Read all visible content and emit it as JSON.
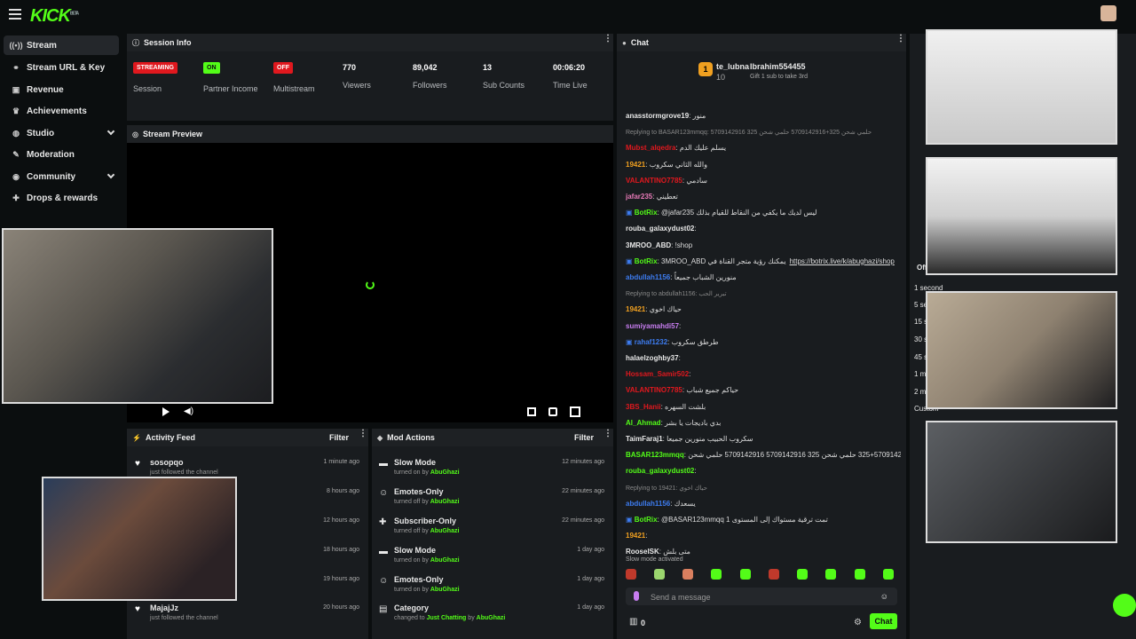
{
  "app": {
    "logo": "KICK",
    "logo_beta": "BETA"
  },
  "sidebar": {
    "items": [
      {
        "label": "Stream",
        "icon": "broadcast-icon",
        "active": true
      },
      {
        "label": "Stream URL & Key",
        "icon": "link-icon"
      },
      {
        "label": "Revenue",
        "icon": "revenue-icon"
      },
      {
        "label": "Achievements",
        "icon": "trophy-icon"
      },
      {
        "label": "Studio",
        "icon": "globe-icon",
        "expandable": true
      },
      {
        "label": "Moderation",
        "icon": "wrench-icon"
      },
      {
        "label": "Community",
        "icon": "community-icon",
        "expandable": true
      },
      {
        "label": "Drops & rewards",
        "icon": "gift-icon"
      }
    ]
  },
  "session": {
    "title": "Session Info",
    "stats": [
      {
        "badge": "STREAMING",
        "badge_color": "#e0181e",
        "label": "Session"
      },
      {
        "badge": "ON",
        "badge_color": "#53fc18",
        "label": "Partner Income"
      },
      {
        "badge": "OFF",
        "badge_color": "#e0181e",
        "label": "Multistream"
      },
      {
        "value": "770",
        "label": "Viewers"
      },
      {
        "value": "89,042",
        "label": "Followers"
      },
      {
        "value": "13",
        "label": "Sub Counts"
      },
      {
        "value": "00:06:20",
        "label": "Time Live"
      }
    ]
  },
  "preview": {
    "title": "Stream Preview"
  },
  "activity": {
    "title": "Activity Feed",
    "filter": "Filter",
    "rows": [
      {
        "user": "sosopqo",
        "action": "just followed the channel",
        "time": "1 minute ago"
      },
      {
        "user": "",
        "action": "",
        "time": "8 hours ago"
      },
      {
        "user": "",
        "action": "",
        "time": "12 hours ago"
      },
      {
        "user": "",
        "action": "",
        "time": "18 hours ago"
      },
      {
        "user": "",
        "action": "",
        "time": "19 hours ago"
      },
      {
        "user": "MajajJz",
        "action": "just followed the channel",
        "time": "20 hours ago"
      }
    ]
  },
  "mod": {
    "title": "Mod Actions",
    "filter": "Filter",
    "rows": [
      {
        "title": "Slow Mode",
        "pre": "turned on by",
        "by": "AbuGhazi",
        "time": "12 minutes ago"
      },
      {
        "title": "Emotes-Only",
        "pre": "turned off by",
        "by": "AbuGhazi",
        "time": "22 minutes ago"
      },
      {
        "title": "Subscriber-Only",
        "pre": "turned off by",
        "by": "AbuGhazi",
        "time": "22 minutes ago"
      },
      {
        "title": "Slow Mode",
        "pre": "turned on by",
        "by": "AbuGhazi",
        "time": "1 day ago"
      },
      {
        "title": "Emotes-Only",
        "pre": "turned on by",
        "by": "AbuGhazi",
        "time": "1 day ago"
      },
      {
        "title": "Category",
        "pre": "changed to",
        "cat": "Just Chatting",
        "by_pre": "by",
        "by": "AbuGhazi",
        "time": "1 day ago"
      }
    ]
  },
  "chat": {
    "title": "Chat",
    "pinned": {
      "rank": "1",
      "user": "te_lubna",
      "count": "10",
      "user2": "Ibrahim554455",
      "gift": "Gift 1 sub to take 3rd"
    },
    "messages": [
      {
        "user": "anasstormgrove19",
        "color": "#e8e8e8",
        "text": "منور"
      },
      {
        "reply": "Replying to BASAR123mmqq: 5709142916 حلمي شحن 325+5709142916 حلمي شحن 325"
      },
      {
        "user": "Mubst_alqedra",
        "color": "#e0181e",
        "text": "يسلم عليك الدم"
      },
      {
        "user": "19421",
        "color": "#f0a020",
        "text": "والله الثاني سكروب"
      },
      {
        "user": "VALANTINO7785",
        "color": "#e0181e",
        "text": "سادمي"
      },
      {
        "user": "jafar235",
        "color": "#e87ab8",
        "text": "تعطيني"
      },
      {
        "user": "BotRix",
        "color": "#53fc18",
        "bot": true,
        "text": "@jafar235 ليس لديك ما يكفي من النقاط للقيام بذلك"
      },
      {
        "user": "rouba_galaxydust02",
        "color": "#e8e8e8",
        "text": ""
      },
      {
        "user": "3MROO_ABD",
        "color": "#e8e8e8",
        "text": "!shop"
      },
      {
        "user": "BotRix",
        "color": "#53fc18",
        "bot": true,
        "text": "3MROO_ABD يمكنك رؤية متجر القناة في",
        "link": "https://botrix.live/k/abughazi/shop"
      },
      {
        "user": "abdullah1156",
        "color": "#3d7cf0",
        "text": "منورين الشباب جميعاً"
      },
      {
        "reply": "Replying to abdullah1156: تبرير الحب"
      },
      {
        "user": "19421",
        "color": "#f0a020",
        "text": "حياك اخوي"
      },
      {
        "user": "sumiyamahdi57",
        "color": "#c77df0",
        "text": ""
      },
      {
        "user": "rahaf1232",
        "color": "#3d7cf0",
        "bot": true,
        "text": "طرطق سكروب"
      },
      {
        "user": "halaelzoghby37",
        "color": "#e8e8e8",
        "text": ""
      },
      {
        "user": "Hossam_Samir502",
        "color": "#e0181e",
        "text": ""
      },
      {
        "user": "VALANTINO7785",
        "color": "#e0181e",
        "text": "حياكم جميع شباب"
      },
      {
        "user": "3BS_Hanii",
        "color": "#e0181e",
        "text": "بلشت السهره"
      },
      {
        "user": "Al_Ahmad",
        "color": "#53fc18",
        "text": "بدي باديجات يا بشر"
      },
      {
        "user": "TaimFaraj1",
        "color": "#e8e8e8",
        "text": "سكروب الحبيب منورين جميعا"
      },
      {
        "user": "BASAR123mmqq",
        "color": "#53fc18",
        "text": "حلمي شحن 5709142916+325 حلمي شحن 325 5709142916 5709142916 حلمي شحن"
      },
      {
        "user": "rouba_galaxydust02",
        "color": "#53fc18",
        "text": ""
      },
      {
        "reply": "Replying to 19421: حياك اخوي"
      },
      {
        "user": "abdullah1156",
        "color": "#3d7cf0",
        "text": "يسعدك"
      },
      {
        "user": "BotRix",
        "color": "#53fc18",
        "bot": true,
        "text": "@BASAR123mmqq 1 تمت ترقية مستواك إلى المستوى"
      },
      {
        "user": "19421",
        "color": "#f0a020",
        "text": ""
      },
      {
        "user": "RooselSK",
        "color": "#e8e8e8",
        "text": "متى بلش"
      }
    ],
    "slow_mode": "Slow mode activated",
    "placeholder": "Send a message",
    "points": "0",
    "send": "Chat"
  },
  "right_panel": {
    "items": [
      "Off",
      "1 second",
      "5 se",
      "15 s",
      "30 s",
      "45 s",
      "1 mi",
      "2 m",
      "Custom"
    ]
  }
}
